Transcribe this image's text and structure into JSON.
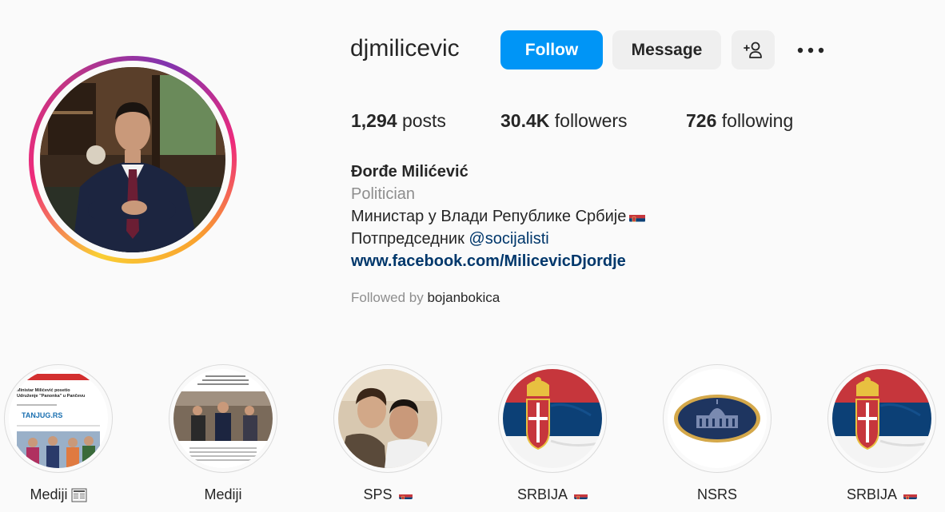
{
  "profile": {
    "username": "djmilicevic",
    "follow_label": "Follow",
    "message_label": "Message",
    "add_user_icon": "person-add-icon",
    "more_icon": "more-horizontal-icon",
    "posts_count": "1,294",
    "posts_label": "posts",
    "followers_count": "30.4K",
    "followers_label": "followers",
    "following_count": "726",
    "following_label": "following",
    "full_name": "Đorđe Milićević",
    "category": "Politician",
    "bio_line1": "Министар у Влади Републике Србије",
    "bio_line2_prefix": "Потпредседник",
    "bio_mention": "@socijalisti",
    "website": "www.facebook.com/MilicevicDjordje",
    "followed_by_prefix": "Followed by",
    "followed_by_user": "bojanbokica"
  },
  "colors": {
    "follow_button": "#0095f6",
    "secondary_button": "#efefef",
    "link": "#00376b",
    "muted_text": "#8e8e8e"
  },
  "highlights": [
    {
      "label": "Mediji",
      "icon": "newspaper-icon"
    },
    {
      "label": "Mediji"
    },
    {
      "label": "SPS",
      "icon": "serbian-flag-icon"
    },
    {
      "label": "SRBIJA",
      "icon": "serbian-flag-icon"
    },
    {
      "label": "NSRS"
    },
    {
      "label": "SRBIJA",
      "icon": "serbian-flag-icon"
    }
  ],
  "highlight_thumbs": {
    "tanjug_text": "TANJUG.RS",
    "news_headline": "Ministar Milićević posetio Udruženje \"Panonka\" u Pančevu"
  }
}
